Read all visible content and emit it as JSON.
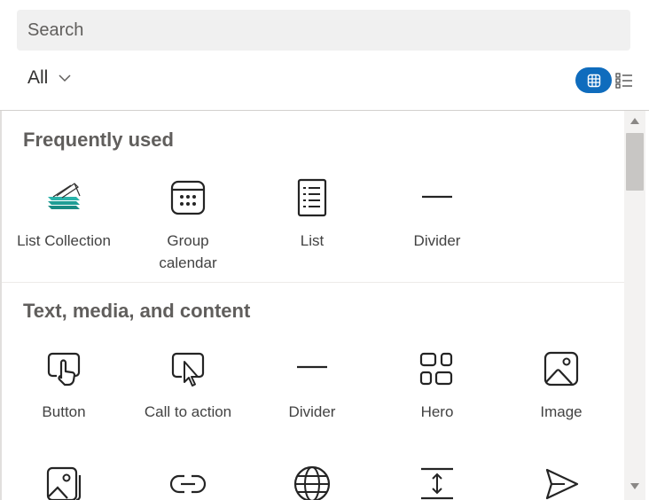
{
  "search": {
    "placeholder": "Search"
  },
  "filter": {
    "label": "All"
  },
  "sections": [
    {
      "title": "Frequently used",
      "items": [
        {
          "label": "List Collection",
          "icon": "list-collection-icon"
        },
        {
          "label": "Group calendar",
          "icon": "calendar-icon"
        },
        {
          "label": "List",
          "icon": "list-icon"
        },
        {
          "label": "Divider",
          "icon": "divider-icon"
        }
      ]
    },
    {
      "title": "Text, media, and content",
      "items": [
        {
          "label": "Button",
          "icon": "button-icon"
        },
        {
          "label": "Call to action",
          "icon": "call-to-action-icon"
        },
        {
          "label": "Divider",
          "icon": "divider-icon"
        },
        {
          "label": "Hero",
          "icon": "hero-icon"
        },
        {
          "label": "Image",
          "icon": "image-icon"
        }
      ]
    }
  ],
  "partial_row_icons": [
    "image-gallery-icon",
    "link-icon",
    "globe-icon",
    "spacer-icon",
    "send-icon"
  ],
  "colors": {
    "accent": "#0f6cbd",
    "teal": "#1f9e96"
  }
}
